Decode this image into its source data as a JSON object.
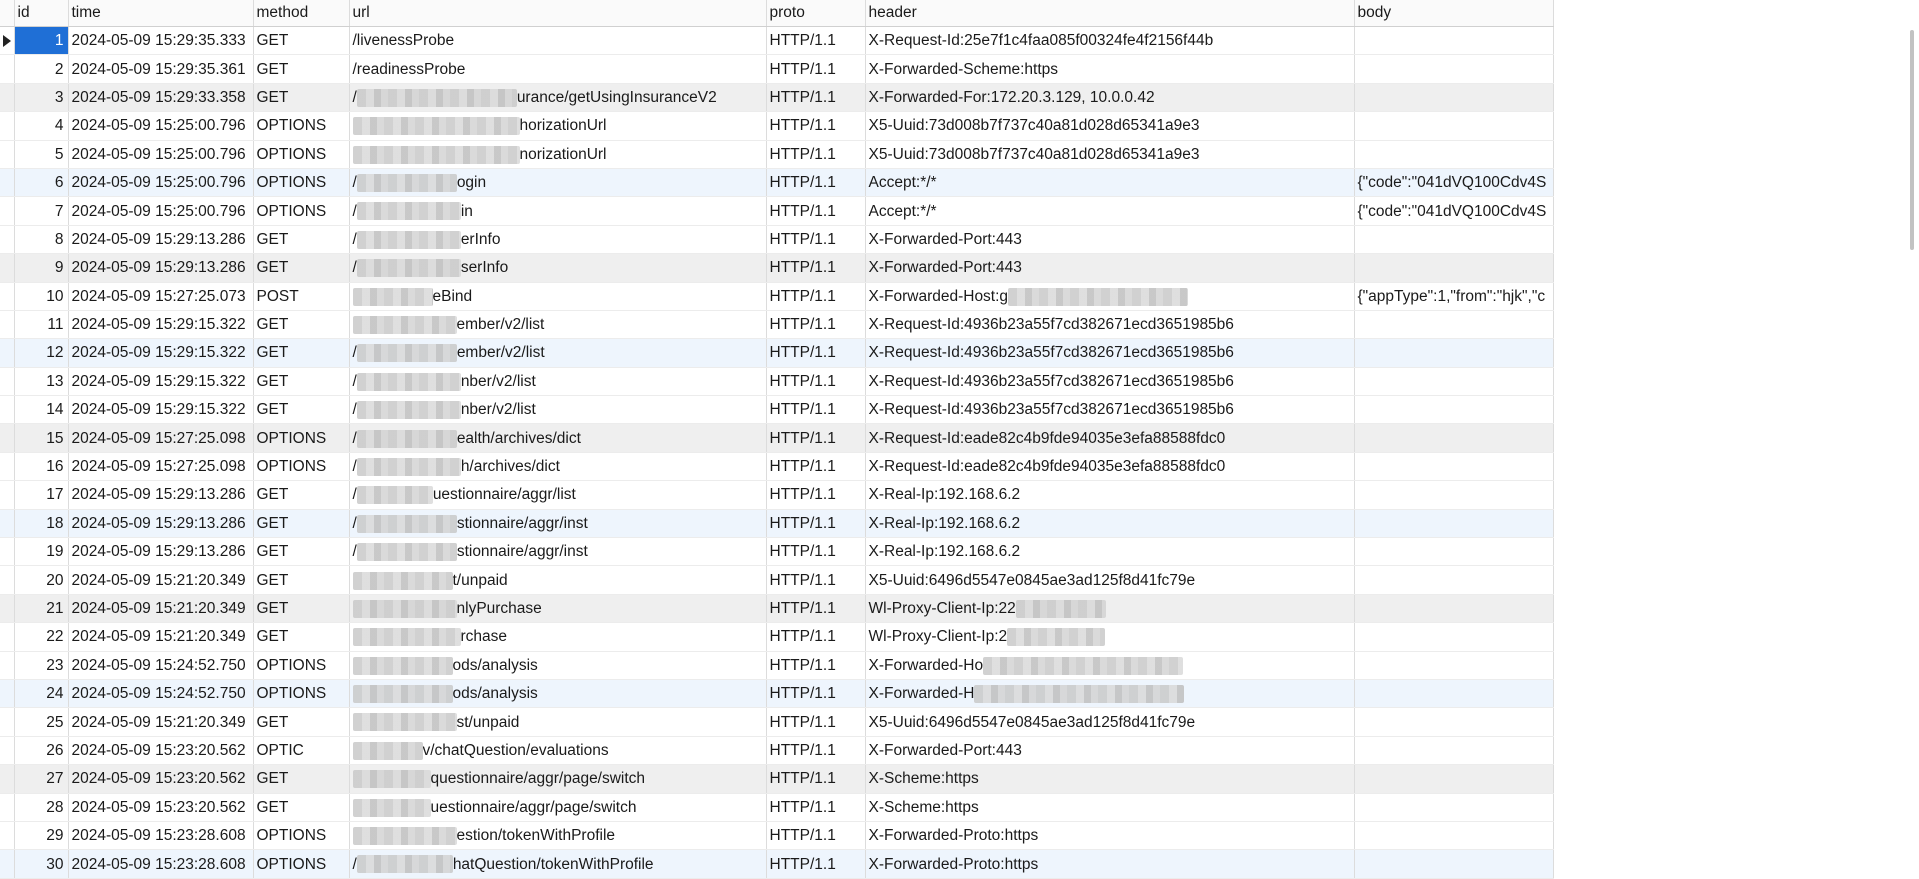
{
  "columns": [
    "id",
    "time",
    "method",
    "url",
    "proto",
    "header",
    "body"
  ],
  "rows": [
    {
      "id": "1",
      "time": "2024-05-09 15:29:35.333",
      "method": "GET",
      "url_pre": "",
      "url_blur": 0,
      "url": "/livenessProbe",
      "proto": "HTTP/1.1",
      "header": "X-Request-Id:25e7f1c4faa085f00324fe4f2156f44b",
      "hdr_blur": 0,
      "body": "",
      "current": true
    },
    {
      "id": "2",
      "time": "2024-05-09 15:29:35.361",
      "method": "GET",
      "url_pre": "",
      "url_blur": 0,
      "url": "/readinessProbe",
      "proto": "HTTP/1.1",
      "header": "X-Forwarded-Scheme:https",
      "hdr_blur": 0,
      "body": ""
    },
    {
      "id": "3",
      "time": "2024-05-09 15:29:33.358",
      "method": "GET",
      "url_pre": "/",
      "url_blur": 160,
      "url": "urance/getUsingInsuranceV2",
      "proto": "HTTP/1.1",
      "header": "X-Forwarded-For:172.20.3.129, 10.0.0.42",
      "hdr_blur": 0,
      "body": ""
    },
    {
      "id": "4",
      "time": "2024-05-09 15:25:00.796",
      "method": "OPTIONS",
      "url_pre": "",
      "url_blur": 167,
      "url": "horizationUrl",
      "proto": "HTTP/1.1",
      "header": "X5-Uuid:73d008b7f737c40a81d028d65341a9e3",
      "hdr_blur": 0,
      "body": ""
    },
    {
      "id": "5",
      "time": "2024-05-09 15:25:00.796",
      "method": "OPTIONS",
      "url_pre": "",
      "url_blur": 167,
      "url": "norizationUrl",
      "proto": "HTTP/1.1",
      "header": "X5-Uuid:73d008b7f737c40a81d028d65341a9e3",
      "hdr_blur": 0,
      "body": ""
    },
    {
      "id": "6",
      "time": "2024-05-09 15:25:00.796",
      "method": "OPTIONS",
      "url_pre": "/",
      "url_blur": 100,
      "url": "ogin",
      "proto": "HTTP/1.1",
      "header": "Accept:*/*",
      "hdr_blur": 0,
      "body": "{\"code\":\"041dVQ100Cdv4S"
    },
    {
      "id": "7",
      "time": "2024-05-09 15:25:00.796",
      "method": "OPTIONS",
      "url_pre": "/",
      "url_blur": 104,
      "url": "in",
      "proto": "HTTP/1.1",
      "header": "Accept:*/*",
      "hdr_blur": 0,
      "body": "{\"code\":\"041dVQ100Cdv4S"
    },
    {
      "id": "8",
      "time": "2024-05-09 15:29:13.286",
      "method": "GET",
      "url_pre": "/",
      "url_blur": 104,
      "url": "erInfo",
      "proto": "HTTP/1.1",
      "header": "X-Forwarded-Port:443",
      "hdr_blur": 0,
      "body": ""
    },
    {
      "id": "9",
      "time": "2024-05-09 15:29:13.286",
      "method": "GET",
      "url_pre": "/",
      "url_blur": 104,
      "url": "serInfo",
      "proto": "HTTP/1.1",
      "header": "X-Forwarded-Port:443",
      "hdr_blur": 0,
      "body": ""
    },
    {
      "id": "10",
      "time": "2024-05-09 15:27:25.073",
      "method": "POST",
      "url_pre": "",
      "url_blur": 80,
      "url": "eBind",
      "proto": "HTTP/1.1",
      "header": "X-Forwarded-Host:g",
      "hdr_blur": 180,
      "body": "{\"appType\":1,\"from\":\"hjk\",\"c"
    },
    {
      "id": "11",
      "time": "2024-05-09 15:29:15.322",
      "method": "GET",
      "url_pre": "",
      "url_blur": 104,
      "url": "ember/v2/list",
      "proto": "HTTP/1.1",
      "header": "X-Request-Id:4936b23a55f7cd382671ecd3651985b6",
      "hdr_blur": 0,
      "body": ""
    },
    {
      "id": "12",
      "time": "2024-05-09 15:29:15.322",
      "method": "GET",
      "url_pre": "/",
      "url_blur": 100,
      "url": "ember/v2/list",
      "proto": "HTTP/1.1",
      "header": "X-Request-Id:4936b23a55f7cd382671ecd3651985b6",
      "hdr_blur": 0,
      "body": ""
    },
    {
      "id": "13",
      "time": "2024-05-09 15:29:15.322",
      "method": "GET",
      "url_pre": "/",
      "url_blur": 104,
      "url": "nber/v2/list",
      "proto": "HTTP/1.1",
      "header": "X-Request-Id:4936b23a55f7cd382671ecd3651985b6",
      "hdr_blur": 0,
      "body": ""
    },
    {
      "id": "14",
      "time": "2024-05-09 15:29:15.322",
      "method": "GET",
      "url_pre": "/",
      "url_blur": 104,
      "url": "nber/v2/list",
      "proto": "HTTP/1.1",
      "header": "X-Request-Id:4936b23a55f7cd382671ecd3651985b6",
      "hdr_blur": 0,
      "body": ""
    },
    {
      "id": "15",
      "time": "2024-05-09 15:27:25.098",
      "method": "OPTIONS",
      "url_pre": "/",
      "url_blur": 100,
      "url": "ealth/archives/dict",
      "proto": "HTTP/1.1",
      "header": "X-Request-Id:eade82c4b9fde94035e3efa88588fdc0",
      "hdr_blur": 0,
      "body": ""
    },
    {
      "id": "16",
      "time": "2024-05-09 15:27:25.098",
      "method": "OPTIONS",
      "url_pre": "/",
      "url_blur": 104,
      "url": "h/archives/dict",
      "proto": "HTTP/1.1",
      "header": "X-Request-Id:eade82c4b9fde94035e3efa88588fdc0",
      "hdr_blur": 0,
      "body": ""
    },
    {
      "id": "17",
      "time": "2024-05-09 15:29:13.286",
      "method": "GET",
      "url_pre": "/",
      "url_blur": 76,
      "url": "uestionnaire/aggr/list",
      "proto": "HTTP/1.1",
      "header": "X-Real-Ip:192.168.6.2",
      "hdr_blur": 0,
      "body": ""
    },
    {
      "id": "18",
      "time": "2024-05-09 15:29:13.286",
      "method": "GET",
      "url_pre": "/",
      "url_blur": 100,
      "url": "stionnaire/aggr/inst",
      "proto": "HTTP/1.1",
      "header": "X-Real-Ip:192.168.6.2",
      "hdr_blur": 0,
      "body": ""
    },
    {
      "id": "19",
      "time": "2024-05-09 15:29:13.286",
      "method": "GET",
      "url_pre": "/",
      "url_blur": 100,
      "url": "stionnaire/aggr/inst",
      "proto": "HTTP/1.1",
      "header": "X-Real-Ip:192.168.6.2",
      "hdr_blur": 0,
      "body": ""
    },
    {
      "id": "20",
      "time": "2024-05-09 15:21:20.349",
      "method": "GET",
      "url_pre": "",
      "url_blur": 100,
      "url": "t/unpaid",
      "proto": "HTTP/1.1",
      "header": "X5-Uuid:6496d5547e0845ae3ad125f8d41fc79e",
      "hdr_blur": 0,
      "body": ""
    },
    {
      "id": "21",
      "time": "2024-05-09 15:21:20.349",
      "method": "GET",
      "url_pre": "",
      "url_blur": 104,
      "url": "nlyPurchase",
      "proto": "HTTP/1.1",
      "header": "Wl-Proxy-Client-Ip:22",
      "hdr_blur": 90,
      "body": ""
    },
    {
      "id": "22",
      "time": "2024-05-09 15:21:20.349",
      "method": "GET",
      "url_pre": "",
      "url_blur": 108,
      "url": "rchase",
      "proto": "HTTP/1.1",
      "header": "Wl-Proxy-Client-Ip:2",
      "hdr_blur": 98,
      "body": ""
    },
    {
      "id": "23",
      "time": "2024-05-09 15:24:52.750",
      "method": "OPTIONS",
      "url_pre": "",
      "url_blur": 100,
      "url": "ods/analysis",
      "proto": "HTTP/1.1",
      "header": "X-Forwarded-Ho",
      "hdr_blur": 200,
      "body": ""
    },
    {
      "id": "24",
      "time": "2024-05-09 15:24:52.750",
      "method": "OPTIONS",
      "url_pre": "",
      "url_blur": 100,
      "url": "ods/analysis",
      "proto": "HTTP/1.1",
      "header": "X-Forwarded-H",
      "hdr_blur": 210,
      "body": ""
    },
    {
      "id": "25",
      "time": "2024-05-09 15:21:20.349",
      "method": "GET",
      "url_pre": "",
      "url_blur": 104,
      "url": "st/unpaid",
      "proto": "HTTP/1.1",
      "header": "X5-Uuid:6496d5547e0845ae3ad125f8d41fc79e",
      "hdr_blur": 0,
      "body": ""
    },
    {
      "id": "26",
      "time": "2024-05-09 15:23:20.562",
      "method": "OPTIC",
      "url_pre": "",
      "url_blur": 70,
      "url": "v/chatQuestion/evaluations",
      "proto": "HTTP/1.1",
      "header": "X-Forwarded-Port:443",
      "hdr_blur": 0,
      "body": ""
    },
    {
      "id": "27",
      "time": "2024-05-09 15:23:20.562",
      "method": "GET",
      "url_pre": "",
      "url_blur": 78,
      "url": "questionnaire/aggr/page/switch",
      "proto": "HTTP/1.1",
      "header": "X-Scheme:https",
      "hdr_blur": 0,
      "body": ""
    },
    {
      "id": "28",
      "time": "2024-05-09 15:23:20.562",
      "method": "GET",
      "url_pre": "",
      "url_blur": 78,
      "url": "uestionnaire/aggr/page/switch",
      "proto": "HTTP/1.1",
      "header": "X-Scheme:https",
      "hdr_blur": 0,
      "body": ""
    },
    {
      "id": "29",
      "time": "2024-05-09 15:23:28.608",
      "method": "OPTIONS",
      "url_pre": "",
      "url_blur": 104,
      "url": "estion/tokenWithProfile",
      "proto": "HTTP/1.1",
      "header": "X-Forwarded-Proto:https",
      "hdr_blur": 0,
      "body": ""
    },
    {
      "id": "30",
      "time": "2024-05-09 15:23:28.608",
      "method": "OPTIONS",
      "url_pre": "/",
      "url_blur": 96,
      "url": "hatQuestion/tokenWithProfile",
      "proto": "HTTP/1.1",
      "header": "X-Forwarded-Proto:https",
      "hdr_blur": 0,
      "body": ""
    }
  ],
  "row_shading": [
    "a",
    "a",
    "b",
    "a",
    "a",
    "c",
    "a",
    "a",
    "b",
    "a",
    "a",
    "c",
    "a",
    "a",
    "b",
    "a",
    "a",
    "c",
    "a",
    "a",
    "b",
    "a",
    "a",
    "c",
    "a",
    "a",
    "b",
    "a",
    "a",
    "c"
  ],
  "colors": {
    "selection": "#1f6fd6",
    "alt_row": "#efefef",
    "alt_row_blue": "#eef5fd"
  }
}
